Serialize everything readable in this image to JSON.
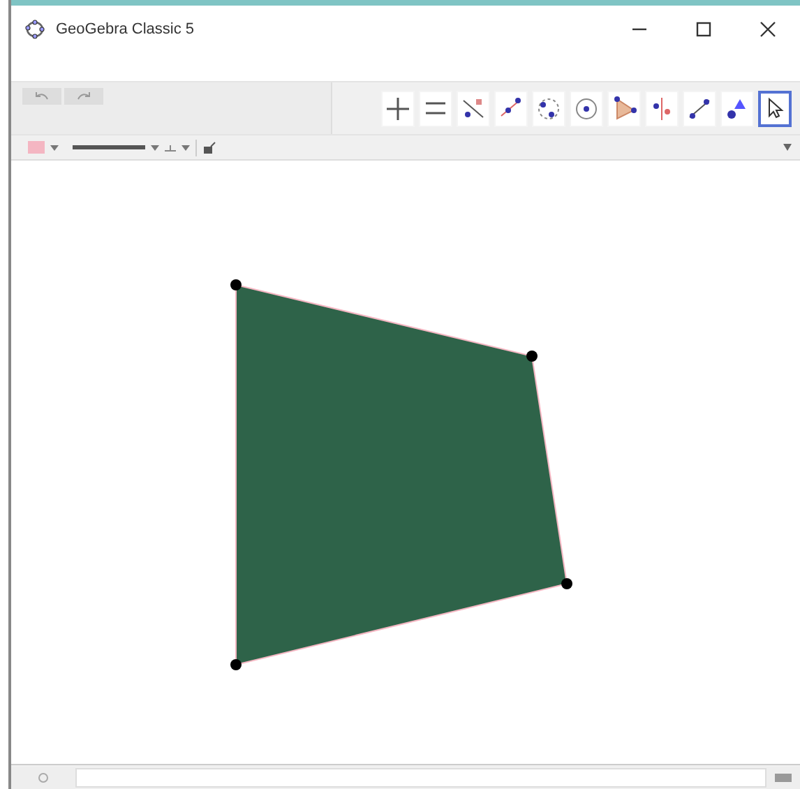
{
  "window": {
    "title": "GeoGebra Classic 5"
  },
  "tools": [
    {
      "selected": false
    },
    {
      "selected": false
    },
    {
      "selected": false
    },
    {
      "selected": false
    },
    {
      "selected": false
    },
    {
      "selected": false
    },
    {
      "selected": false
    },
    {
      "selected": false
    },
    {
      "selected": false
    },
    {
      "selected": false
    },
    {
      "selected": true
    }
  ],
  "style_bar": {
    "color": "#f4b6c2"
  },
  "graphics": {
    "objects": [
      {
        "kind": "polygon",
        "color": "#2e6349"
      },
      {
        "kind": "point"
      },
      {
        "kind": "point"
      },
      {
        "kind": "point"
      },
      {
        "kind": "point"
      }
    ]
  }
}
